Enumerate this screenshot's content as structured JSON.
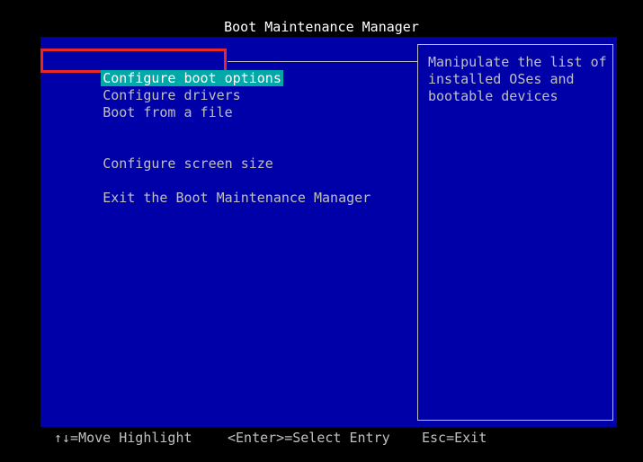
{
  "title": "Boot Maintenance Manager",
  "menu": {
    "items": [
      {
        "label": "Configure boot options"
      },
      {
        "label": "Configure drivers"
      },
      {
        "label": "Boot from a file"
      },
      {
        "label": "Configure screen size"
      },
      {
        "label": "Exit the Boot Maintenance Manager"
      }
    ],
    "selected_index": 0
  },
  "help": {
    "text": "Manipulate the list of installed OSes and bootable devices"
  },
  "footer": {
    "move": "↑↓=Move Highlight",
    "select": "<Enter>=Select Entry",
    "exit": "Esc=Exit"
  },
  "colors": {
    "background": "#0000a8",
    "highlight": "#00a8a8",
    "focus_outline": "#e8262c"
  }
}
